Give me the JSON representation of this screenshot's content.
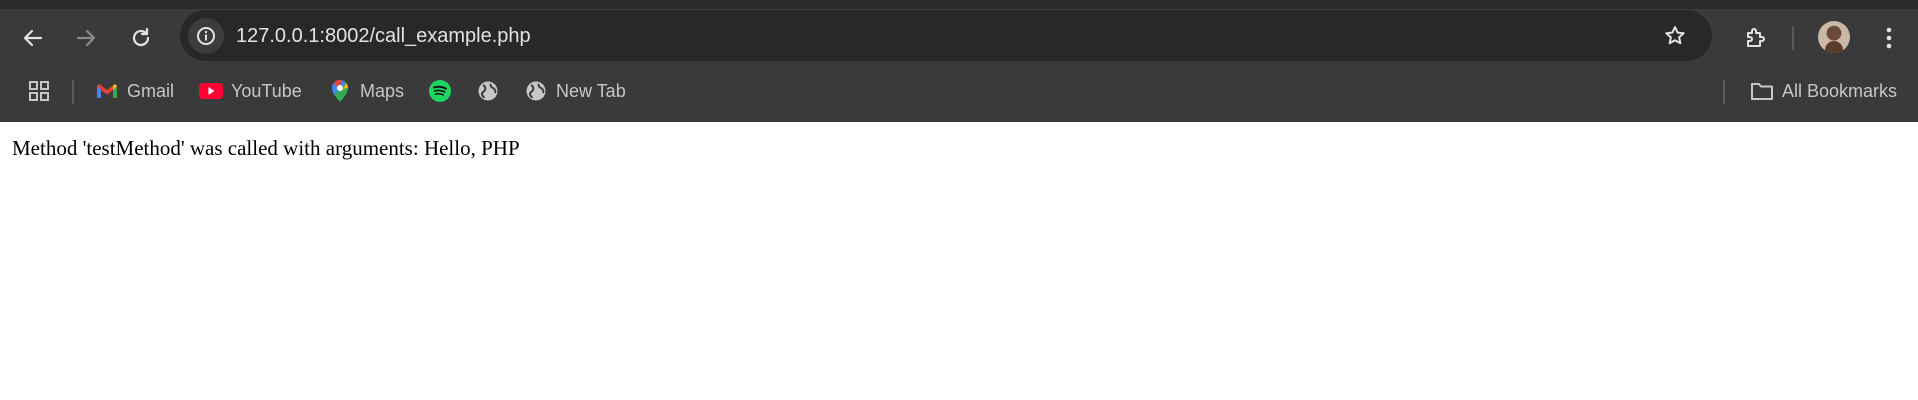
{
  "address_bar": {
    "url": "127.0.0.1:8002/call_example.php"
  },
  "bookmarks": {
    "items": [
      {
        "label": "Gmail",
        "icon": "gmail-icon"
      },
      {
        "label": "YouTube",
        "icon": "youtube-icon"
      },
      {
        "label": "Maps",
        "icon": "maps-icon"
      },
      {
        "label": "",
        "icon": "spotify-icon"
      },
      {
        "label": "",
        "icon": "globe-icon"
      },
      {
        "label": "New Tab",
        "icon": "globe-icon"
      }
    ],
    "all_bookmarks_label": "All Bookmarks"
  },
  "page": {
    "body_text": "Method 'testMethod' was called with arguments: Hello, PHP"
  },
  "colors": {
    "toolbar_bg": "#3a3a3a",
    "omnibox_bg": "#282828",
    "url_text": "#e3e3e3",
    "bookmark_text": "#c7c7c7",
    "page_bg": "#ffffff"
  }
}
